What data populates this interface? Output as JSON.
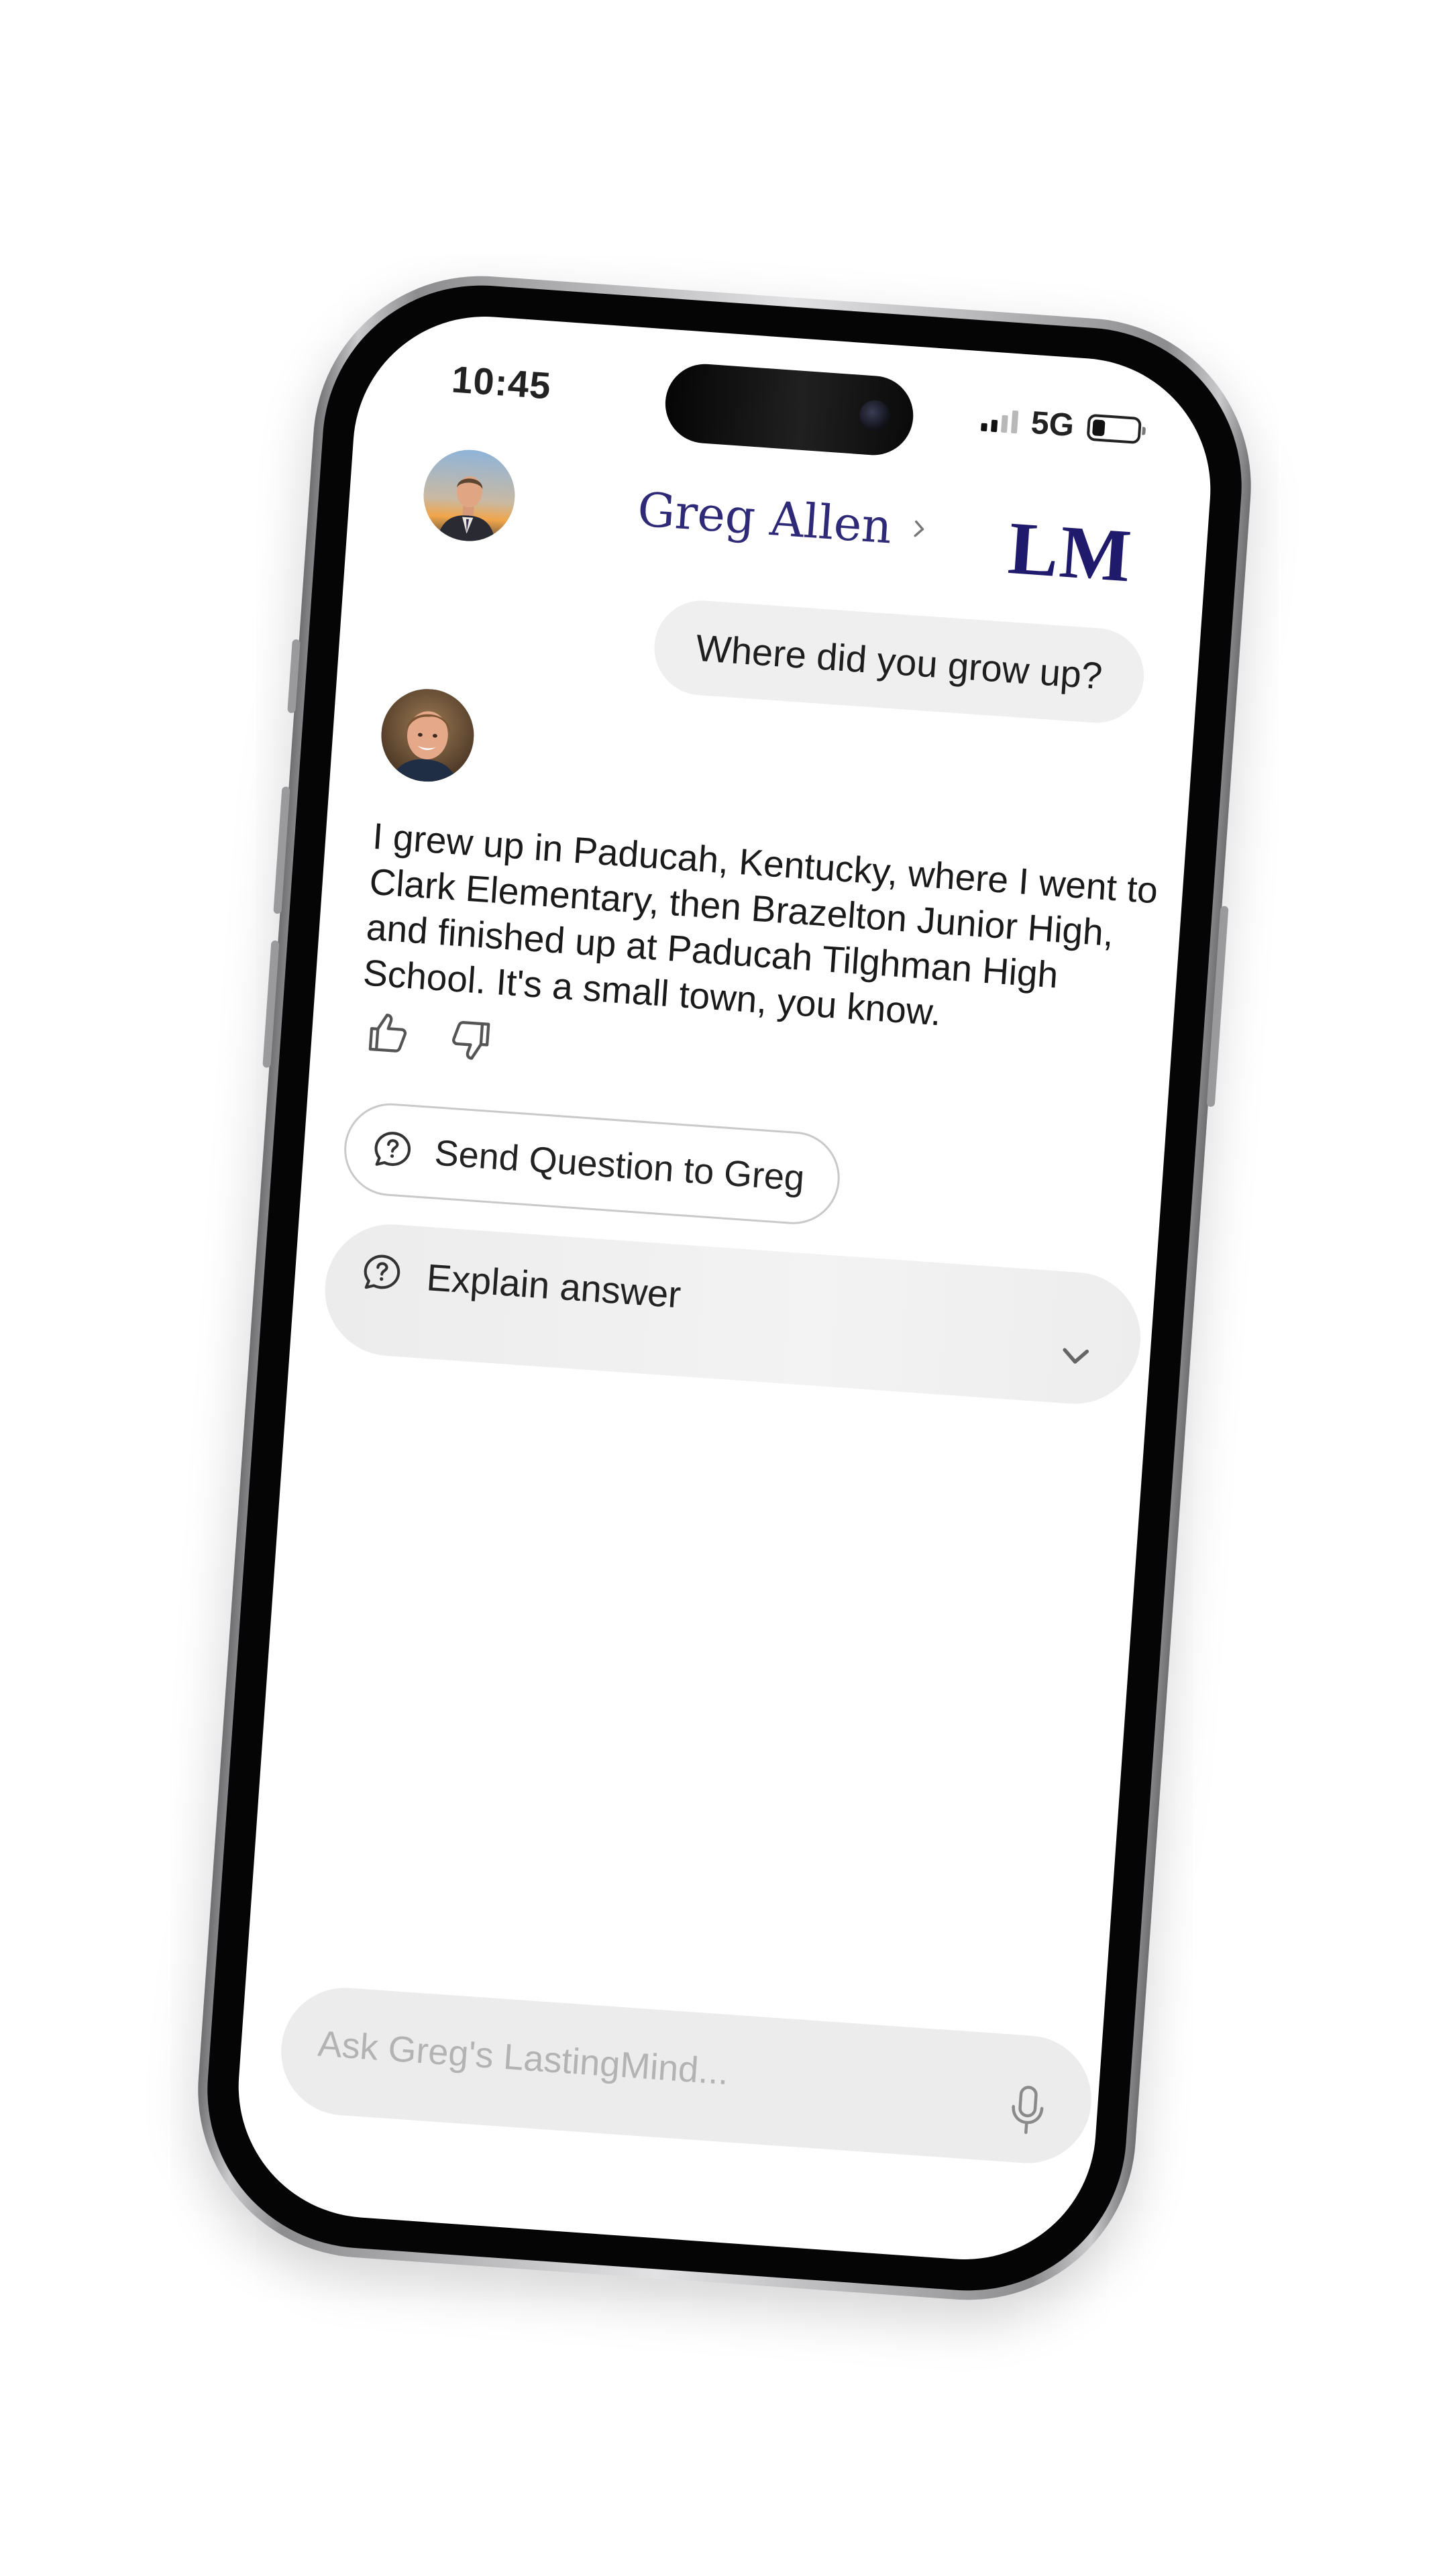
{
  "status_bar": {
    "time": "10:45",
    "network": "5G",
    "battery_level": 0.28
  },
  "header": {
    "contact_name": "Greg Allen",
    "logo": "LM",
    "icons": [
      "avatar",
      "chevron-right-icon"
    ]
  },
  "conversation": {
    "user_message": "Where did you grow up?",
    "bot_message": "I grew up in Paducah, Kentucky, where I went to Clark Elementary, then Brazelton Junior High, and finished up at Paducah Tilghman High School. It's a small town, you know.",
    "feedback_icons": [
      "thumbs-up-icon",
      "thumbs-down-icon"
    ]
  },
  "actions": {
    "send_question_label": "Send Question to Greg",
    "explain_label": "Explain answer",
    "icons": [
      "question-bubble-icon",
      "chevron-down-icon"
    ]
  },
  "composer": {
    "placeholder": "Ask Greg's LastingMind...",
    "value": "",
    "icon": "microphone-icon"
  },
  "colors": {
    "brand": "#1f1a6b",
    "name": "#2e2a78",
    "bubble": "#efefef",
    "panel": "#ececec"
  }
}
